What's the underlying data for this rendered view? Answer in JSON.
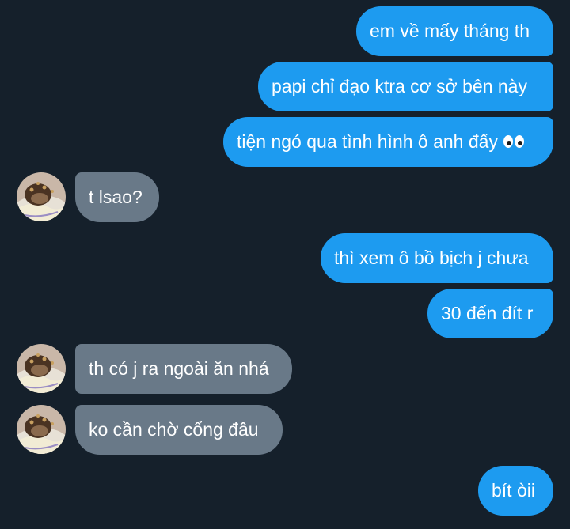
{
  "conversation": {
    "messages": [
      {
        "sender": "me",
        "text": "em về mấy tháng th"
      },
      {
        "sender": "me",
        "text": "papi chỉ đạo ktra cơ sở bên này"
      },
      {
        "sender": "me",
        "text": "tiện ngó qua tình hình ô anh đấy",
        "emoji_icon": "eyes-icon"
      },
      {
        "sender": "other",
        "text": "t lsao?"
      },
      {
        "sender": "me",
        "text": "thì xem ô bồ bịch j chưa"
      },
      {
        "sender": "me",
        "text": "30 đến đít r"
      },
      {
        "sender": "other",
        "text": "th có j ra ngoài ăn nhá"
      },
      {
        "sender": "other",
        "text": "ko cần chờ cổng đâu"
      },
      {
        "sender": "me",
        "text": "bít òii"
      }
    ]
  },
  "colors": {
    "background": "#15202b",
    "outgoing_bubble": "#1d9bf0",
    "incoming_bubble": "#697988",
    "text": "#ffffff"
  }
}
